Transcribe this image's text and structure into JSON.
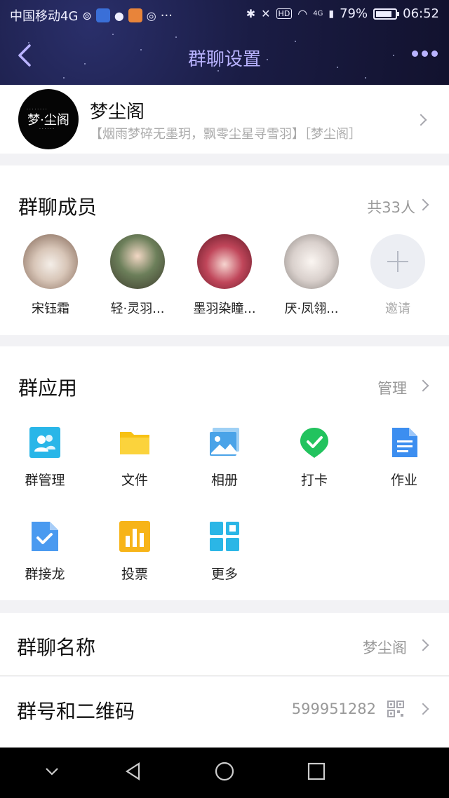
{
  "status_bar": {
    "carrier": "中国移动4G",
    "battery": "79%",
    "time": "06:52",
    "network_tag": "4G",
    "hd_tag": "HD"
  },
  "header": {
    "title": "群聊设置",
    "back_icon": "back-chevron-icon",
    "more_icon": "more-dots-icon"
  },
  "group": {
    "name": "梦尘阁",
    "description": "【烟雨梦碎无墨玥，飘零尘星寻雪羽】［梦尘阁］",
    "avatar_text": "梦·尘阁"
  },
  "members": {
    "title": "群聊成员",
    "count_label": "共33人",
    "list": [
      {
        "name": "宋钰霜"
      },
      {
        "name": "轻·灵羽..."
      },
      {
        "name": "墨羽染瞳..."
      },
      {
        "name": "厌·凤翎..."
      }
    ],
    "invite_label": "邀请"
  },
  "apps": {
    "title": "群应用",
    "manage_label": "管理",
    "items": [
      {
        "label": "群管理",
        "icon": "group-manage-icon",
        "color": "#29b6e8"
      },
      {
        "label": "文件",
        "icon": "folder-icon",
        "color": "#f7c114"
      },
      {
        "label": "相册",
        "icon": "photo-album-icon",
        "color": "#4aa3e8"
      },
      {
        "label": "打卡",
        "icon": "check-in-icon",
        "color": "#22c35e"
      },
      {
        "label": "作业",
        "icon": "homework-icon",
        "color": "#3c8ef0"
      },
      {
        "label": "群接龙",
        "icon": "relay-icon",
        "color": "#4a9af0"
      },
      {
        "label": "投票",
        "icon": "vote-icon",
        "color": "#f7b418"
      },
      {
        "label": "更多",
        "icon": "more-apps-icon",
        "color": "#2bb6e6"
      }
    ]
  },
  "rows": {
    "name_title": "群聊名称",
    "name_value": "梦尘阁",
    "number_title": "群号和二维码",
    "number_value": "599951282"
  }
}
